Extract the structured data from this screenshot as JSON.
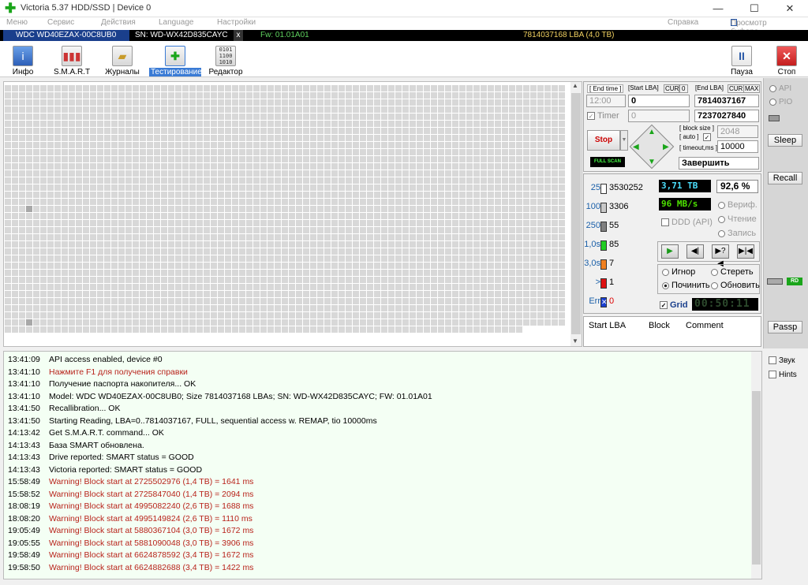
{
  "titlebar": {
    "title": "Victoria 5.37 HDD/SSD | Device 0",
    "minimize": "—",
    "maximize": "☐",
    "close": "✕"
  },
  "menu": {
    "items": [
      "Меню",
      "Сервис",
      "Действия",
      "Language",
      "Настройки"
    ],
    "help": "Справка",
    "buffer": "Просмотр буфера"
  },
  "device": {
    "model": "WDC WD40EZAX-00C8UB0",
    "sn": "SN: WD-WX42D835CAYC",
    "close": "x",
    "fw": "Fw: 01.01A01",
    "lba": "7814037168 LBA (4,0 TB)"
  },
  "toolbar": {
    "info": "Инфо",
    "smart": "S.M.A.R.T",
    "logs": "Журналы",
    "test": "Тестирование",
    "editor": "Редактор",
    "pause": "Пауза",
    "stop": "Стоп"
  },
  "controls": {
    "end_time_label": "[ End time ]",
    "start_lba_label": "[Start LBA]",
    "cur1": "CUR",
    "zero": "0",
    "end_lba_label": "[End LBA]",
    "cur2": "CUR",
    "max": "MAX",
    "end_time": "12:00",
    "start_lba": "0",
    "end_lba": "7814037167",
    "timer_label": "Timer",
    "timer_value": "0",
    "current_lba": "7237027840",
    "stop_btn": "Stop",
    "full_scan": "FULL SCAN",
    "block_size_label": "[ block size ]",
    "auto_label": "[ auto ]",
    "timeout_label": "[ timeout,ms ]",
    "block_size": "2048",
    "timeout": "10000",
    "finish_action": "Завершить"
  },
  "stats": {
    "rows": [
      {
        "label": "25",
        "count": "3530252",
        "color": "#ffffff"
      },
      {
        "label": "100",
        "count": "3306",
        "color": "#c8c8c8"
      },
      {
        "label": "250",
        "count": "55",
        "color": "#808080"
      },
      {
        "label": "1,0s",
        "count": "85",
        "color": "#22cc22"
      },
      {
        "label": "3,0s",
        "count": "7",
        "color": "#f08020"
      },
      {
        "label": ">",
        "count": "1",
        "color": "#dd1111"
      },
      {
        "label": "Err",
        "count": "0",
        "color": "#1a3fd0"
      }
    ],
    "progress_tb": "3,71 TB",
    "percent": "92,6",
    "percent_sign": "%",
    "speed": "96 MB/s",
    "ddd": "DDD (API)",
    "verify": "Вериф.",
    "read": "Чтение",
    "write": "Запись",
    "ignore": "Игнор",
    "erase": "Стереть",
    "repair": "Починить",
    "refresh": "Обновить",
    "grid_label": "Grid",
    "elapsed": "00:50:11"
  },
  "buffer_table": {
    "columns": [
      "Start LBA",
      "Block",
      "Comment"
    ]
  },
  "side": {
    "api": "API",
    "pio": "PIO",
    "sleep": "Sleep",
    "recall": "Recall",
    "rd": "RD",
    "passp": "Passp",
    "sound": "Звук",
    "hints": "Hints"
  },
  "log": [
    {
      "t": "13:41:09",
      "m": "API access enabled, device #0",
      "red": false
    },
    {
      "t": "13:41:10",
      "m": "Нажмите F1 для получения справки",
      "red": true
    },
    {
      "t": "13:41:10",
      "m": "Получение паспорта накопителя... OK",
      "red": false
    },
    {
      "t": "13:41:10",
      "m": "Model: WDC WD40EZAX-00C8UB0; Size 7814037168 LBAs; SN: WD-WX42D835CAYC; FW: 01.01A01",
      "red": false
    },
    {
      "t": "13:41:50",
      "m": "Recallibration... OK",
      "red": false
    },
    {
      "t": "13:41:50",
      "m": "Starting Reading, LBA=0..7814037167, FULL, sequential access w. REMAP, tio 10000ms",
      "red": false
    },
    {
      "t": "14:13:42",
      "m": "Get S.M.A.R.T. command... OK",
      "red": false
    },
    {
      "t": "14:13:43",
      "m": "База SMART обновлена.",
      "red": false
    },
    {
      "t": "14:13:43",
      "m": "Drive reported: SMART status = GOOD",
      "red": false
    },
    {
      "t": "14:13:43",
      "m": "Victoria reported: SMART status = GOOD",
      "red": false
    },
    {
      "t": "15:58:49",
      "m": "Warning! Block start at 2725502976 (1,4 TB)  = 1641 ms",
      "red": true
    },
    {
      "t": "15:58:52",
      "m": "Warning! Block start at 2725847040 (1,4 TB)  = 2094 ms",
      "red": true
    },
    {
      "t": "18:08:19",
      "m": "Warning! Block start at 4995082240 (2,6 TB)  = 1688 ms",
      "red": true
    },
    {
      "t": "18:08:20",
      "m": "Warning! Block start at 4995149824 (2,6 TB)  = 1110 ms",
      "red": true
    },
    {
      "t": "19:05:49",
      "m": "Warning! Block start at 5880367104 (3,0 TB)  = 1672 ms",
      "red": true
    },
    {
      "t": "19:05:55",
      "m": "Warning! Block start at 5881090048 (3,0 TB)  = 3906 ms",
      "red": true
    },
    {
      "t": "19:58:49",
      "m": "Warning! Block start at 6624878592 (3,4 TB)  = 1672 ms",
      "red": true
    },
    {
      "t": "19:58:50",
      "m": "Warning! Block start at 6624882688 (3,4 TB)  = 1422 ms",
      "red": true
    }
  ]
}
